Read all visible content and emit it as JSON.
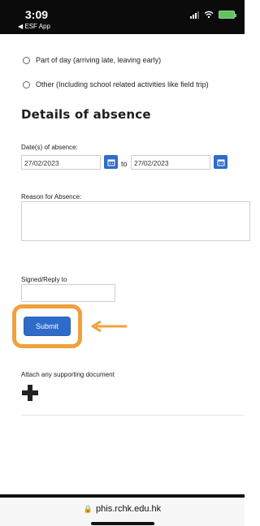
{
  "status": {
    "time": "3:09",
    "back_label": "◀ ESF App"
  },
  "options": [
    {
      "label": "Part of day (arriving late, leaving early)"
    },
    {
      "label": "Other (Including school related activities like field trip)"
    }
  ],
  "section_title": "Details of absence",
  "dates": {
    "label": "Date(s) of absence:",
    "from_value": "27/02/2023",
    "to_label": "to",
    "to_value": "27/02/2023"
  },
  "reason": {
    "label": "Reason for Absence:",
    "value": ""
  },
  "signed": {
    "label": "Signed/Reply to",
    "value": ""
  },
  "submit_label": "Submit",
  "attach_label": "Attach any supporting document",
  "browser": {
    "url": "phis.rchk.edu.hk"
  },
  "colors": {
    "primary": "#2f6cc9",
    "highlight": "#f0a03c"
  }
}
